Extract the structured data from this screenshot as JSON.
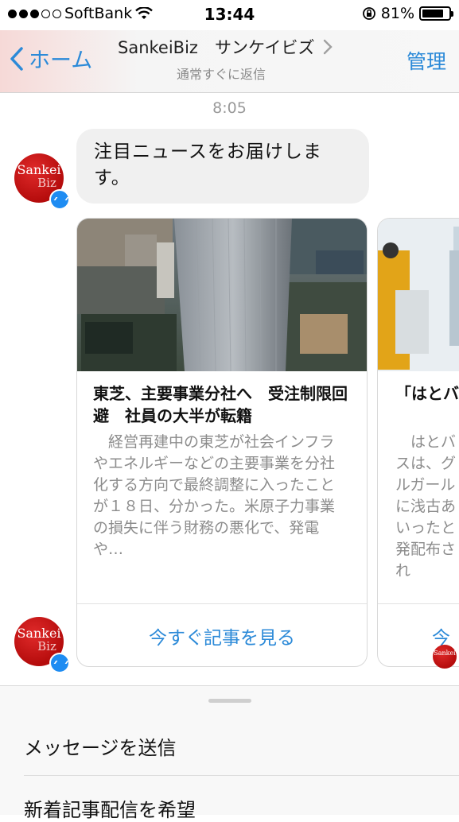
{
  "status": {
    "carrier": "SoftBank",
    "time": "13:44",
    "battery": "81%",
    "battery_level": 0.81
  },
  "nav": {
    "back_label": "ホーム",
    "title": "SankeiBiz　サンケイビズ",
    "subtitle": "通常すぐに返信",
    "manage_label": "管理"
  },
  "chat": {
    "timestamp": "8:05",
    "message": "注目ニュースをお届けします。",
    "avatar_line1": "Sankei",
    "avatar_line2": "Biz",
    "cards": [
      {
        "title": "東芝、主要事業分社へ　受注制限回避　社員の大半が転籍",
        "body": "経営再建中の東芝が社会インフラやエネルギーなどの主要事業を分社化する方向で最終調整に入ったことが１８日、分かった。米原子力事業の損失に伴う財務の悪化で、発電や…",
        "cta": "今すぐ記事を見る"
      },
      {
        "title": "「はとバスは女子大",
        "body": "はとバスは、グルガールに浅古あいったと発配布され",
        "cta": "今"
      }
    ]
  },
  "composer": {
    "items": [
      "メッセージを送信",
      "新着記事配信を希望"
    ]
  },
  "colors": {
    "accent": "#2c8ad8",
    "messenger": "#1e8cf2",
    "brand_red": "#c4161c"
  }
}
